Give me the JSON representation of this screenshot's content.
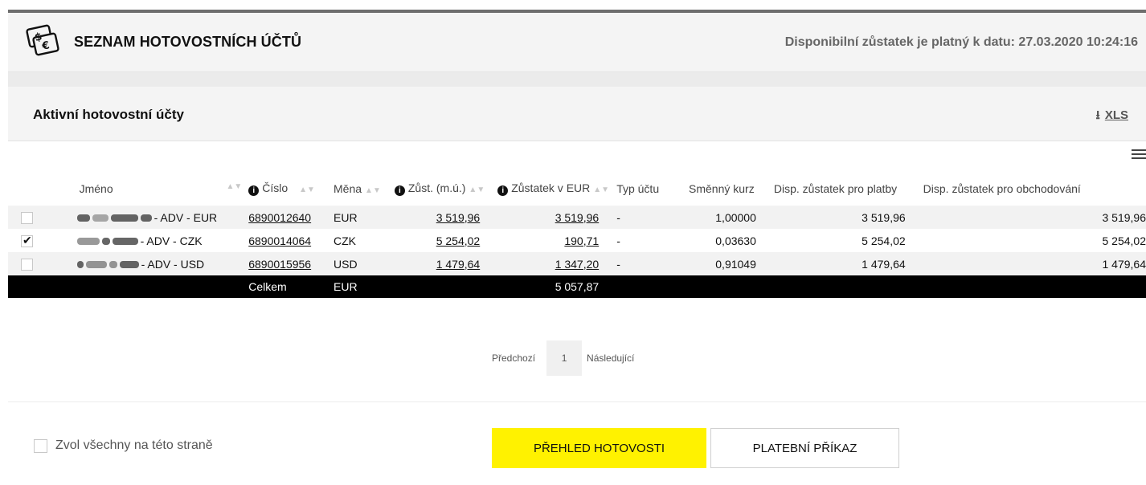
{
  "header": {
    "logo_icon": "cash-icon",
    "title": "SEZNAM HOTOVOSTNÍCH ÚČTŮ",
    "balance_note": "Disponibilní zůstatek je platný k datu: 27.03.2020 10:24:16"
  },
  "section": {
    "title": "Aktivní hotovostní účty",
    "export_label": "XLS",
    "export_icon": "download-icon",
    "menu_icon": "hamburger-menu-icon"
  },
  "table": {
    "columns": {
      "name": "Jméno",
      "number": "Číslo",
      "currency": "Měna",
      "balance": "Zůst. (m.ú.)",
      "balance_eur": "Zůstatek v EUR",
      "type": "Typ účtu",
      "rate": "Směnný kurz",
      "disp_pay": "Disp. zůstatek pro platby",
      "disp_trade": "Disp. zůstatek pro obchodování"
    },
    "rows": [
      {
        "checked": false,
        "name_suffix": "- ADV - EUR",
        "number": "6890012640",
        "currency": "EUR",
        "balance": "3 519,96",
        "balance_eur": "3 519,96",
        "type": "-",
        "rate": "1,00000",
        "disp_pay": "3 519,96",
        "disp_trade": "3 519,96"
      },
      {
        "checked": true,
        "name_suffix": "- ADV - CZK",
        "number": "6890014064",
        "currency": "CZK",
        "balance": "5 254,02",
        "balance_eur": "190,71",
        "type": "-",
        "rate": "0,03630",
        "disp_pay": "5 254,02",
        "disp_trade": "5 254,02"
      },
      {
        "checked": false,
        "name_suffix": "- ADV - USD",
        "number": "6890015956",
        "currency": "USD",
        "balance": "1 479,64",
        "balance_eur": "1 347,20",
        "type": "-",
        "rate": "0,91049",
        "disp_pay": "1 479,64",
        "disp_trade": "1 479,64"
      }
    ],
    "total": {
      "label": "Celkem",
      "currency": "EUR",
      "value": "5 057,87"
    }
  },
  "pager": {
    "prev": "Předchozí",
    "page": "1",
    "next": "Následující"
  },
  "footer": {
    "select_all": "Zvol všechny na této straně",
    "btn_overview": "PŘEHLED HOTOVOSTI",
    "btn_payment": "PLATEBNÍ PŘÍKAZ"
  },
  "colors": {
    "accent_yellow": "#fff200",
    "total_row": "#000000"
  }
}
